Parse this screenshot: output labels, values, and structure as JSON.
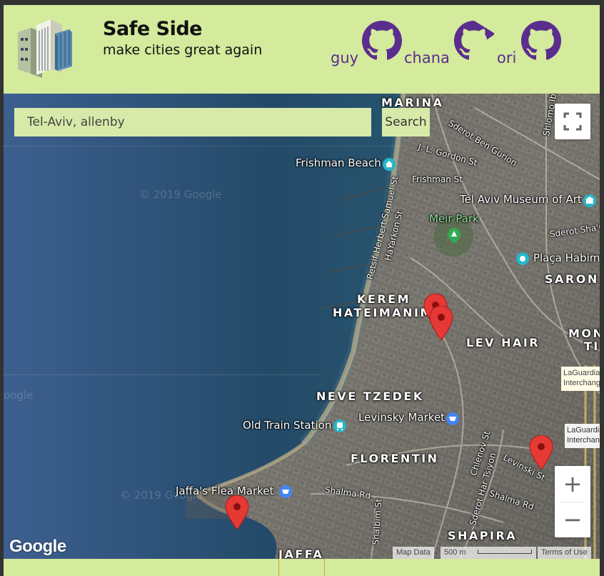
{
  "app": {
    "title": "Safe Side",
    "subtitle": "make cities great again"
  },
  "authors": [
    {
      "name": "guy",
      "icon": "github-icon"
    },
    {
      "name": "chana",
      "icon": "github-icon"
    },
    {
      "name": "ori",
      "icon": "github-icon"
    }
  ],
  "search": {
    "value": "Tel-Aviv, allenby",
    "button_label": "Search"
  },
  "map": {
    "watermark": "© 2019 Google",
    "watermark_partial": "oogle",
    "districts": [
      "MARINA",
      "KEREM",
      "HATEIMANIM",
      "LEV HAIR",
      "NEVE TZEDEK",
      "FLORENTIN",
      "SHAPIRA",
      "JAFFA",
      "SARON",
      "MON",
      "TI"
    ],
    "places": {
      "frishman_beach": "Frishman Beach",
      "meir_park": "Meir Park",
      "museum": "Tel Aviv Museum of Art",
      "plaza": "Plaça Habima",
      "old_train": "Old Train Station",
      "levinsky_market": "Levinsky Market",
      "flea_market": "Jaffa's Flea Market",
      "laguardia1": "LaGuardia Interchange",
      "laguardia2": "LaGuardia Interchange"
    },
    "streets": {
      "ben_gurion": "Sderot Ben Gurion",
      "gordon": "J. L. Gordon St",
      "frishman": "Frishman St",
      "samuel": "Retsif Herbert Samuel St",
      "hayarkon": "HaYarkon St",
      "shlomo": "Shlomo Ibn",
      "shaul": "Sderot Sha'ul",
      "chlenov": "Chlenov St",
      "har_tsiyon": "Sderot Har Tsiyon",
      "levinski": "Levinski St",
      "shalma1": "Shalma Rd",
      "shalma2": "Shalma Rd",
      "shalbim": "Shalbim St"
    },
    "markers_count": 4
  },
  "controls": {
    "zoom_in": "+",
    "zoom_out": "−",
    "fullscreen_icon": "fullscreen-icon"
  },
  "footer": {
    "google": "Google",
    "map_data": "Map Data",
    "scale": "500 m",
    "terms": "Terms of Use"
  },
  "colors": {
    "header_bg": "#d4ea9c",
    "author_text": "#5b2d8e",
    "marker": "#e53935"
  }
}
